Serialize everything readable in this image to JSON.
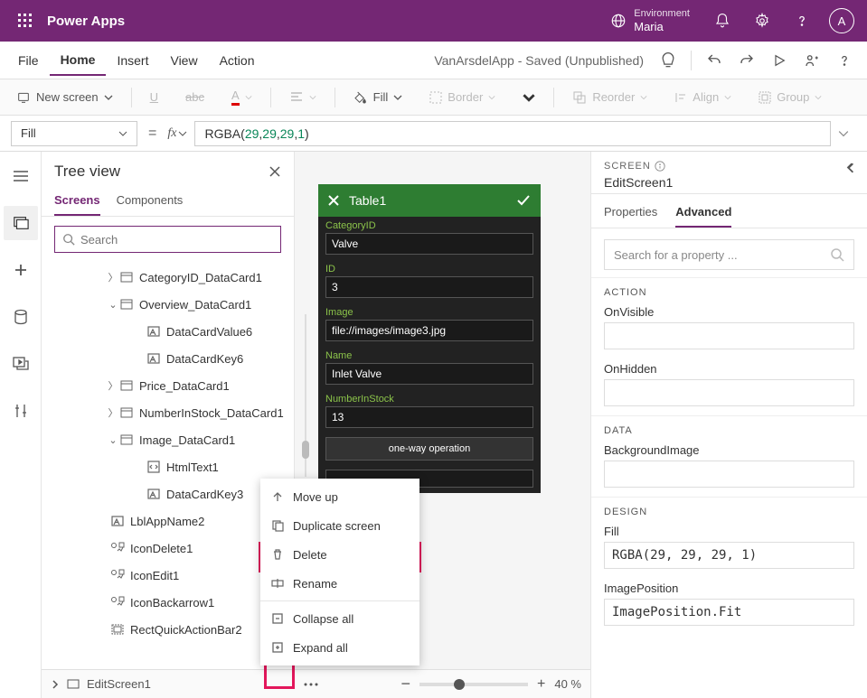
{
  "brand": "Power Apps",
  "environment": {
    "label": "Environment",
    "name": "Maria"
  },
  "avatar": "A",
  "menus": {
    "file": "File",
    "home": "Home",
    "insert": "Insert",
    "view": "View",
    "action": "Action"
  },
  "saved_text": "VanArsdelApp - Saved (Unpublished)",
  "ribbon": {
    "new_screen": "New screen",
    "fill": "Fill",
    "border": "Border",
    "reorder": "Reorder",
    "align": "Align",
    "group": "Group"
  },
  "fx": {
    "property": "Fill",
    "value_fn": "RGBA",
    "value_args": [
      "29",
      "29",
      "29",
      "1"
    ]
  },
  "tree": {
    "title": "Tree view",
    "tabs": {
      "screens": "Screens",
      "components": "Components"
    },
    "search_placeholder": "Search",
    "items": [
      {
        "name": "CategoryID_DataCard1",
        "indent": 28,
        "chev": ">",
        "icon": "card"
      },
      {
        "name": "Overview_DataCard1",
        "indent": 28,
        "chev": "v",
        "icon": "card"
      },
      {
        "name": "DataCardValue6",
        "indent": 58,
        "chev": "",
        "icon": "text"
      },
      {
        "name": "DataCardKey6",
        "indent": 58,
        "chev": "",
        "icon": "text"
      },
      {
        "name": "Price_DataCard1",
        "indent": 28,
        "chev": ">",
        "icon": "card"
      },
      {
        "name": "NumberInStock_DataCard1",
        "indent": 28,
        "chev": ">",
        "icon": "card"
      },
      {
        "name": "Image_DataCard1",
        "indent": 28,
        "chev": "v",
        "icon": "card"
      },
      {
        "name": "HtmlText1",
        "indent": 58,
        "chev": "",
        "icon": "html"
      },
      {
        "name": "DataCardKey3",
        "indent": 58,
        "chev": "",
        "icon": "text"
      },
      {
        "name": "LblAppName2",
        "indent": 18,
        "chev": "",
        "icon": "text"
      },
      {
        "name": "IconDelete1",
        "indent": 18,
        "chev": "",
        "icon": "iconctrl"
      },
      {
        "name": "IconEdit1",
        "indent": 18,
        "chev": "",
        "icon": "iconctrl"
      },
      {
        "name": "IconBackarrow1",
        "indent": 18,
        "chev": "",
        "icon": "iconctrl"
      },
      {
        "name": "RectQuickActionBar2",
        "indent": 18,
        "chev": "",
        "icon": "rect"
      }
    ]
  },
  "selection": {
    "name": "EditScreen1",
    "zoom": "40 %"
  },
  "form": {
    "title": "Table1",
    "fields": [
      {
        "label": "CategoryID",
        "value": "Valve"
      },
      {
        "label": "ID",
        "value": "3"
      },
      {
        "label": "Image",
        "value": "file://images/image3.jpg"
      },
      {
        "label": "Name",
        "value": "Inlet Valve"
      },
      {
        "label": "NumberInStock",
        "value": "13"
      }
    ],
    "oneway": "one-way operation"
  },
  "ctx": {
    "moveup": "Move up",
    "duplicate": "Duplicate screen",
    "delete": "Delete",
    "rename": "Rename",
    "collapse": "Collapse all",
    "expand": "Expand all"
  },
  "props": {
    "screen_label": "SCREEN",
    "screen_name": "EditScreen1",
    "tabs": {
      "properties": "Properties",
      "advanced": "Advanced"
    },
    "search_placeholder": "Search for a property ...",
    "sections": {
      "action": "ACTION",
      "data": "DATA",
      "design": "DESIGN"
    },
    "fields": {
      "onvisible": "OnVisible",
      "onhidden": "OnHidden",
      "bgimage": "BackgroundImage",
      "fill": "Fill",
      "fill_value": "RGBA(29, 29, 29, 1)",
      "imgpos": "ImagePosition",
      "imgpos_value": "ImagePosition.Fit"
    }
  }
}
